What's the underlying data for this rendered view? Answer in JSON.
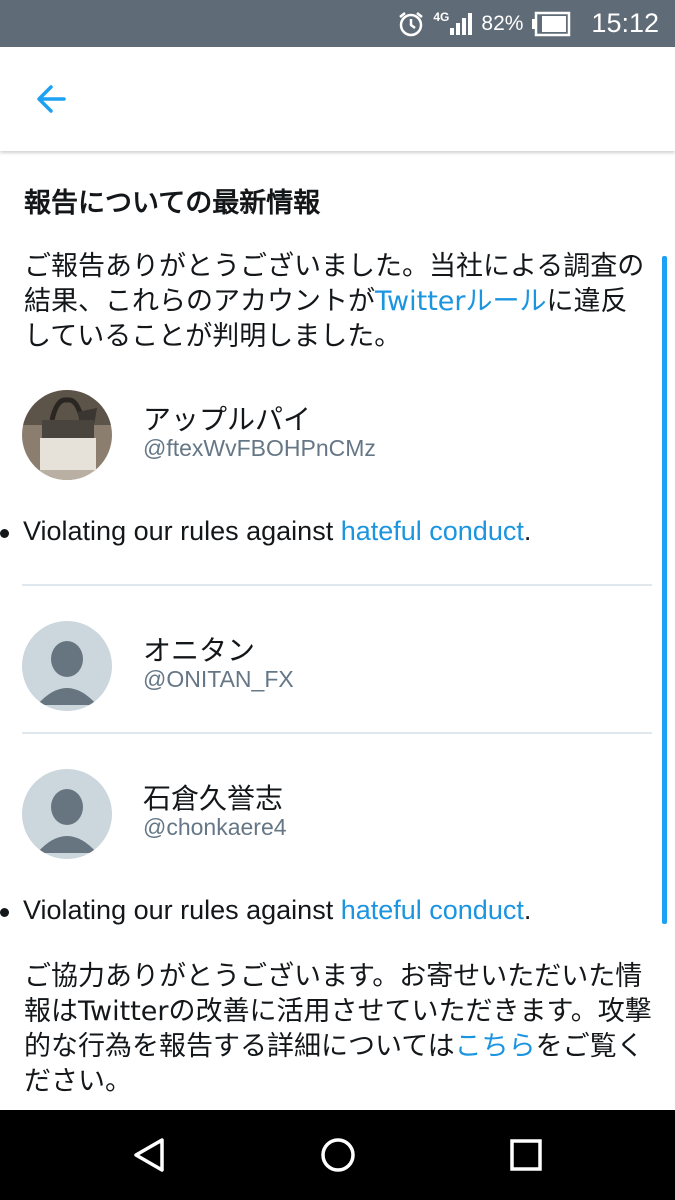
{
  "status_bar": {
    "network": "4G",
    "battery": "82%",
    "time": "15:12"
  },
  "header": {
    "back_icon": "arrow-left-icon"
  },
  "report": {
    "title": "報告についての最新情報",
    "intro_text": "ご報告ありがとうございました。当社による調査の結果、これらのアカウントが",
    "intro_link": "Twitterルール",
    "intro_end": "に違反していることが判明しました。",
    "accounts": [
      {
        "name": "アップルパイ",
        "handle": "@ftexWvFBOHPnCMz"
      },
      {
        "name": "オニタン",
        "handle": "@ONITAN_FX"
      },
      {
        "name": "石倉久誉志",
        "handle": "@chonkaere4"
      }
    ],
    "violation_text": "Violating our rules against ",
    "violation_link": "hateful conduct",
    "violation_end": ".",
    "closing_text": "ご協力ありがとうございます。お寄せいただいた情報はTwitterの改善に活用させていただきます。攻撃的な行為を報告する詳細については",
    "closing_link": "こちら",
    "closing_end": "をご覧ください。"
  },
  "nav": {
    "back": "triangle-back-icon",
    "home": "circle-home-icon",
    "recents": "square-recents-icon"
  },
  "colors": {
    "link": "#1b95e0",
    "status_bar": "#5f6b76",
    "scroll_indicator": "#1da1f2"
  }
}
